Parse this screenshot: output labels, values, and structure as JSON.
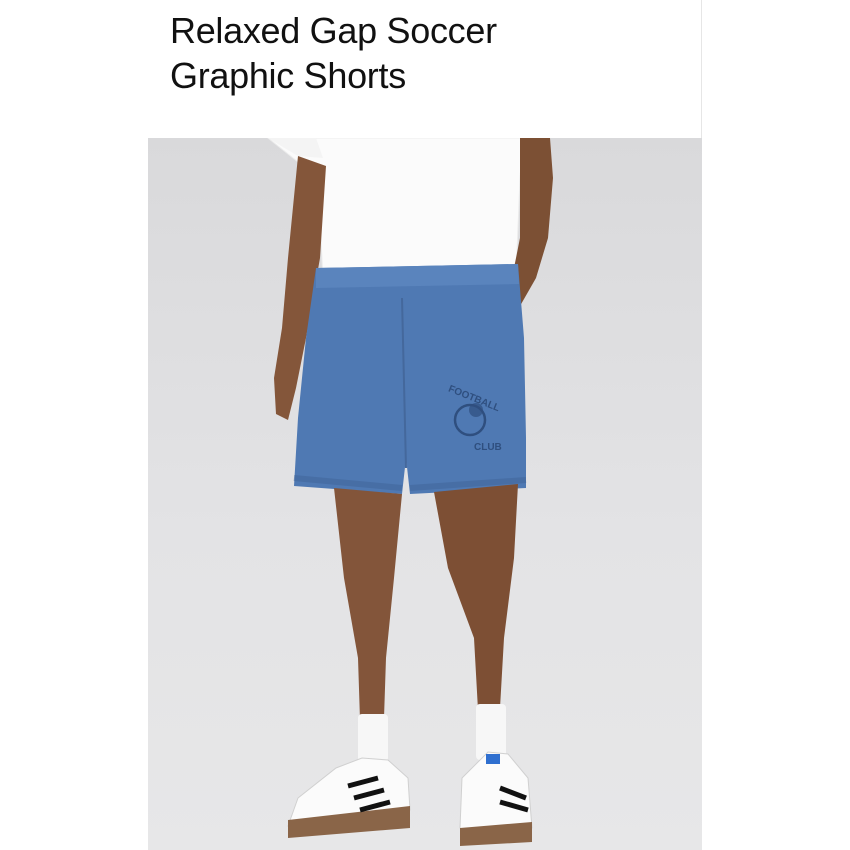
{
  "product": {
    "title_line_1": "Relaxed Gap Soccer",
    "title_line_2": "Graphic Shorts"
  },
  "image": {
    "subject": "model-wearing-shorts",
    "graphic_text_top": "FOOTBALL",
    "graphic_text_bottom": "CLUB"
  },
  "colors": {
    "background": "#e0e0e2",
    "shorts": "#4f79b3",
    "tshirt": "#ffffff",
    "skin": "#8a5a3c",
    "graphic_ink": "#2f4f7f"
  }
}
